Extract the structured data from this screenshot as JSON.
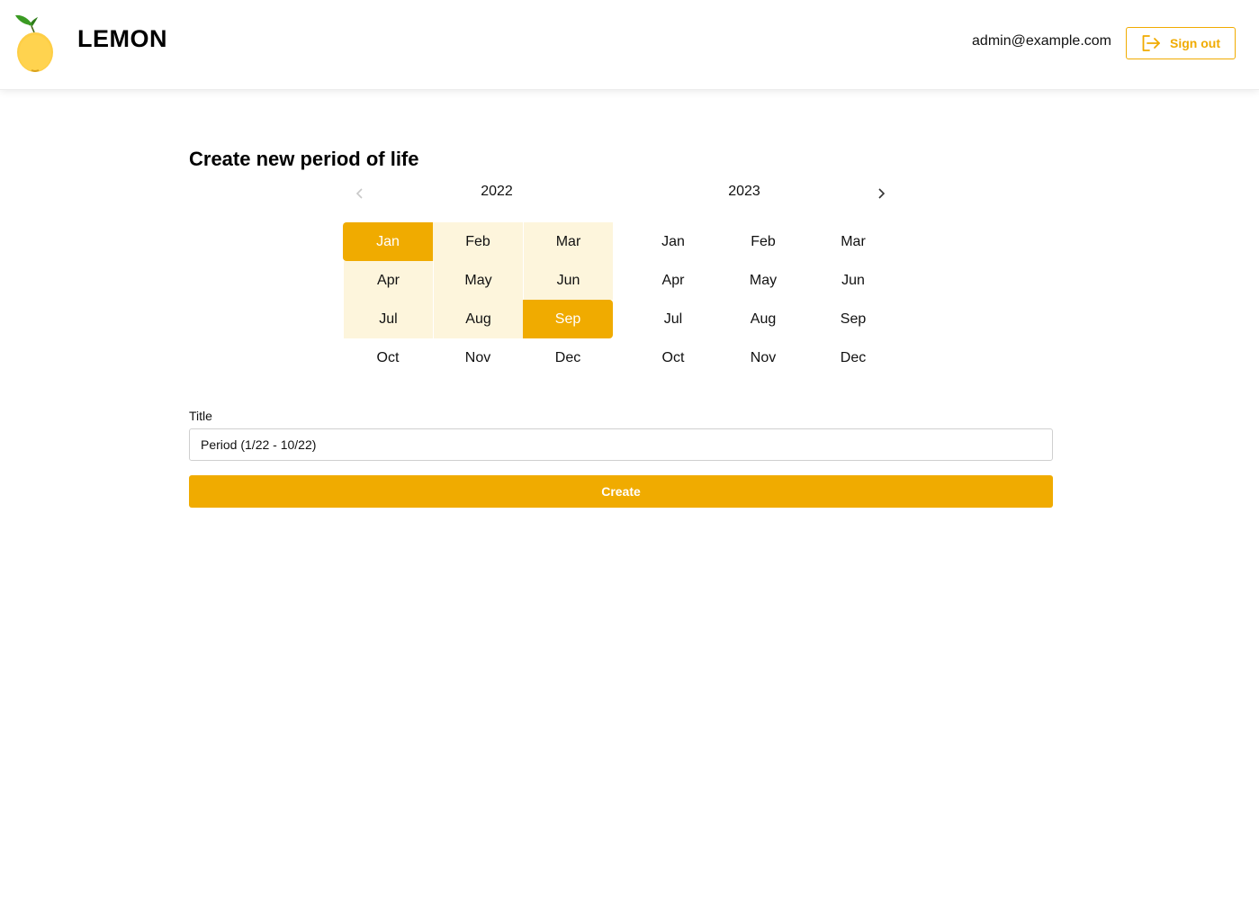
{
  "app": {
    "brand": "LEMON",
    "logo_icon": "lemon-icon"
  },
  "header": {
    "user_email": "admin@example.com",
    "signout_label": "Sign out",
    "signout_icon": "sign-out-icon"
  },
  "page": {
    "title": "Create new period of life"
  },
  "calendar": {
    "prev_icon": "chevron-left-icon",
    "next_icon": "chevron-right-icon",
    "prev_disabled": true,
    "years": [
      {
        "label": "2022",
        "months": [
          "Jan",
          "Feb",
          "Mar",
          "Apr",
          "May",
          "Jun",
          "Jul",
          "Aug",
          "Sep",
          "Oct",
          "Nov",
          "Dec"
        ]
      },
      {
        "label": "2023",
        "months": [
          "Jan",
          "Feb",
          "Mar",
          "Apr",
          "May",
          "Jun",
          "Jul",
          "Aug",
          "Sep",
          "Oct",
          "Nov",
          "Dec"
        ]
      }
    ],
    "selection": {
      "start": "Jan 2022",
      "end": "Sep 2022"
    }
  },
  "form": {
    "title_label": "Title",
    "title_value": "Period (1/22 - 10/22)",
    "create_label": "Create"
  },
  "colors": {
    "accent": "#f0ab00",
    "range_fill": "#fdf5dc"
  }
}
